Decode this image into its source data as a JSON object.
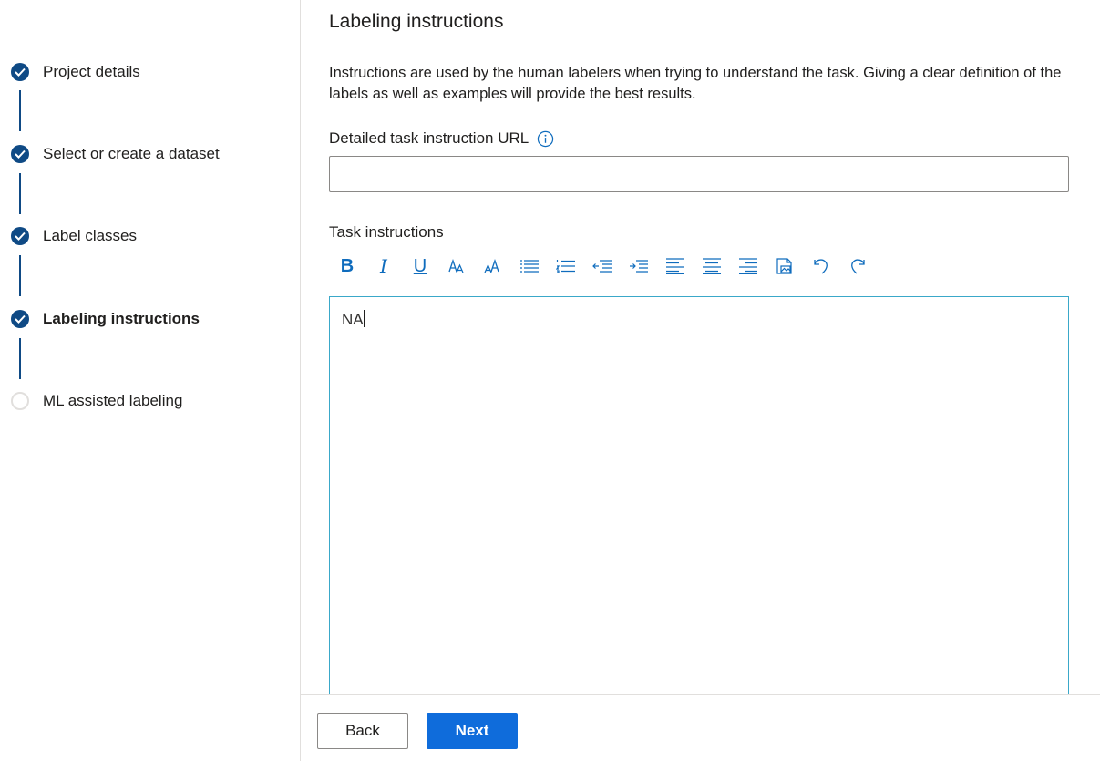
{
  "stepper": {
    "steps": [
      {
        "label": "Project details",
        "status": "completed"
      },
      {
        "label": "Select or create a dataset",
        "status": "completed"
      },
      {
        "label": "Label classes",
        "status": "completed"
      },
      {
        "label": "Labeling instructions",
        "status": "current"
      },
      {
        "label": "ML assisted labeling",
        "status": "pending"
      }
    ]
  },
  "main": {
    "title": "Labeling instructions",
    "description": "Instructions are used by the human labelers when trying to understand the task. Giving a clear definition of the labels as well as examples will provide the best results.",
    "url_field": {
      "label": "Detailed task instruction URL",
      "value": "",
      "icon": "info-icon"
    },
    "task_instructions": {
      "label": "Task instructions",
      "toolbar": [
        "bold",
        "italic",
        "underline",
        "font-size",
        "font-size-alt",
        "bulleted-list",
        "numbered-list",
        "decrease-indent",
        "increase-indent",
        "align-left",
        "align-center",
        "align-right",
        "insert-image",
        "undo",
        "redo"
      ],
      "toolbar_glyphs": {
        "bold": "B",
        "italic": "I",
        "underline": "U"
      },
      "content": "NA"
    }
  },
  "footer": {
    "back_label": "Back",
    "next_label": "Next"
  },
  "colors": {
    "accent": "#0f6cdb",
    "step_done": "#0f4a85",
    "editor_border": "#3aa8c9",
    "icon": "#0f6cbd"
  }
}
